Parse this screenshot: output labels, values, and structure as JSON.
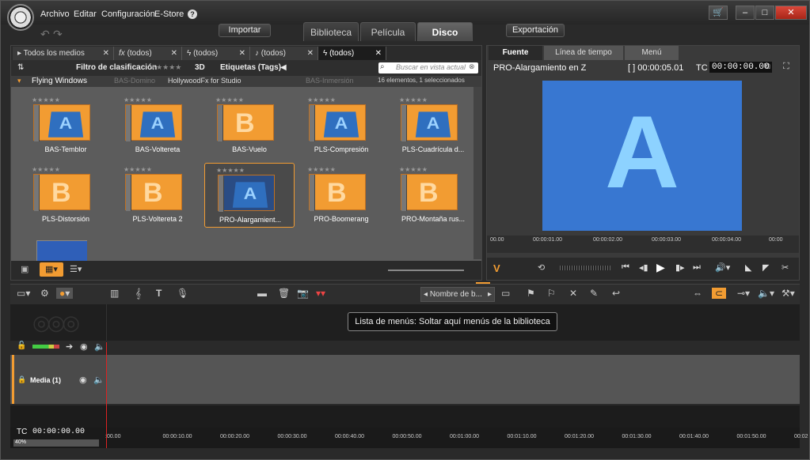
{
  "menu": [
    "Archivo",
    "Editar",
    "Configuración",
    "E-Store"
  ],
  "help_icon": "?",
  "toolbar": {
    "import": "Importar",
    "export": "Exportación"
  },
  "main_tabs": [
    "Biblioteca",
    "Película",
    "Disco"
  ],
  "window_buttons": {
    "store": "🛒",
    "minimize": "‒",
    "maximize": "□",
    "close": "✕"
  },
  "library": {
    "tabs": [
      "Todos los medios",
      "(todos)",
      "(todos)",
      "(todos)",
      "(todos)"
    ],
    "filter_label": "Filtro de clasificación",
    "filter_stars": "★★★★★",
    "three_d": "3D",
    "tags_label": "Etiquetas (Tags)",
    "search_placeholder": "Buscar en vista actual",
    "folder": "Flying Windows",
    "folder_sub": "HollywoodFx for Studio",
    "counter": "16 elementos, 1 seleccionados",
    "items": [
      "BAS-Temblor",
      "BAS-Voltereta",
      "BAS-Vuelo",
      "PLS-Compresión",
      "PLS-Cuadrícula d...",
      "PLS-Distorsión",
      "PLS-Voltereta 2",
      "PRO-Alargamient...",
      "PRO-Boomerang",
      "PRO-Montaña rus..."
    ],
    "item_stars": "★★★★★",
    "ghost_labels": [
      "BAS-Domino",
      "BAS-Inmersión"
    ]
  },
  "preview": {
    "tabs": [
      "Fuente",
      "Línea de tiempo",
      "Menú"
    ],
    "clip": "PRO-Alargamiento en Z",
    "duration": "[ ] 00:00:05.01",
    "tc_label": "TC",
    "tc": "00:00:00.00",
    "screen_letter": "A",
    "ruler": [
      "00.00",
      "00:00:01.00",
      "00:00:02.00",
      "00:00:03.00",
      "00:00:04.00",
      "00:00"
    ]
  },
  "timeline": {
    "sort_label": "Nombre de b...",
    "tooltip": "Lista de menús: Soltar aquí menús de la biblioteca",
    "track_name": "Media (1)",
    "tc_label": "TC",
    "tc": "00:00:00.00",
    "zoom": "40%",
    "ruler": [
      ":00.00",
      "00:00:10.00",
      "00:00:20.00",
      "00:00:30.00",
      "00:00:40.00",
      "00:00:50.00",
      "00:01:00.00",
      "00:01:10.00",
      "00:01:20.00",
      "00:01:30.00",
      "00:01:40.00",
      "00:01:50.00",
      "00:02"
    ]
  }
}
